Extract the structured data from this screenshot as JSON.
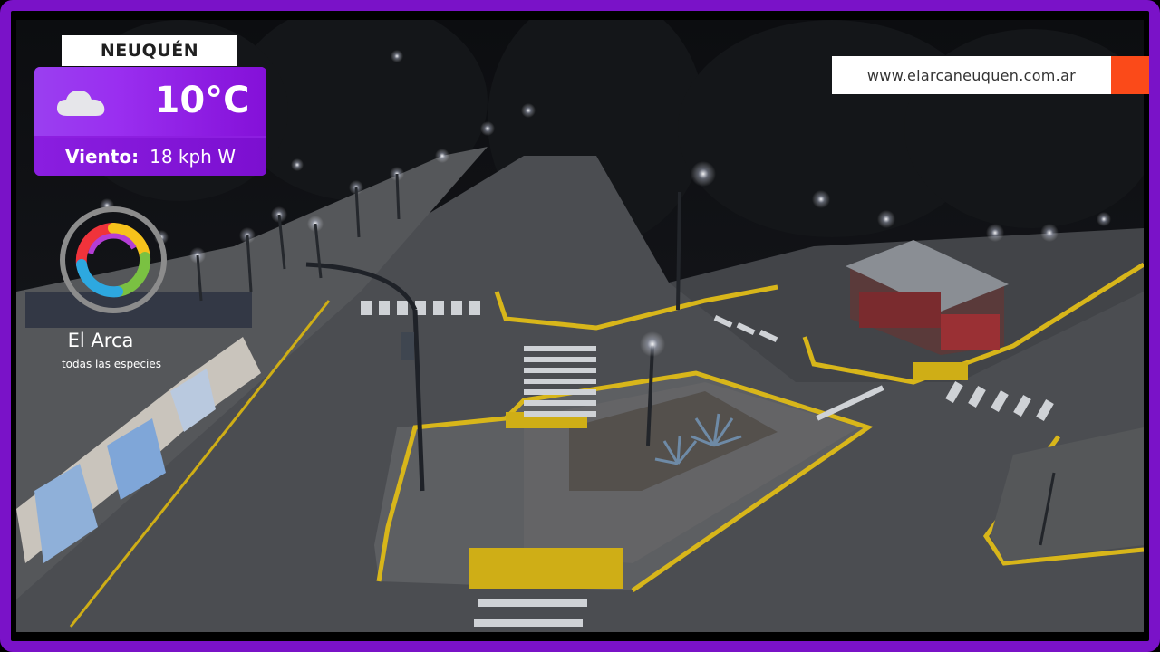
{
  "overlay": {
    "city": "NEUQUÉN",
    "temperature": "10°C",
    "weather_icon": "cloud-icon",
    "wind_label": "Viento:",
    "wind_value": "18 kph W",
    "website": "www.elarcaneuquen.com.ar",
    "brand_name": "El Arca",
    "brand_tagline": "todas las especies"
  },
  "colors": {
    "frame": "#7a12c8",
    "weather_panel": "#8d1ee0",
    "url_accent": "#fb4a19",
    "curb_yellow": "#d8b61a"
  }
}
